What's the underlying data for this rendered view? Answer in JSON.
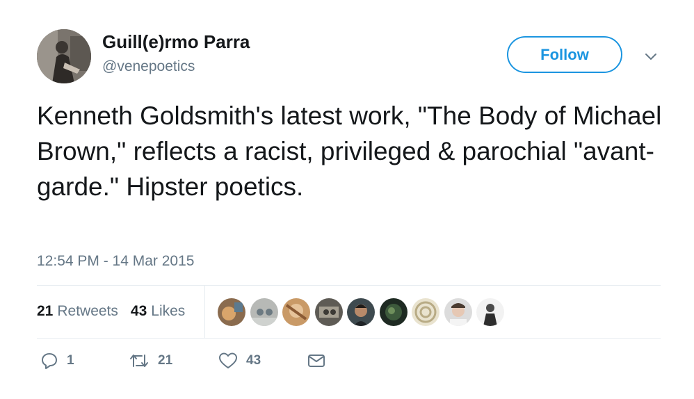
{
  "author": {
    "name": "Guill(e)rmo Parra",
    "handle": "@venepoetics",
    "avatar_icon": "profile-photo"
  },
  "follow_label": "Follow",
  "more_icon": "chevron-down-icon",
  "tweet": {
    "text": "Kenneth Goldsmith's latest work, \"The Body of Michael Brown,\" reflects a racist, privileged & parochial \"avant-garde.\" Hipster poetics.",
    "timestamp": "12:54 PM - 14 Mar 2015"
  },
  "stats": {
    "retweets_count": "21",
    "retweets_label": "Retweets",
    "likes_count": "43",
    "likes_label": "Likes"
  },
  "likers_count_shown": 9,
  "actions": {
    "reply_count": "1",
    "retweet_count": "21",
    "like_count": "43"
  },
  "colors": {
    "accent": "#1b95e0",
    "muted": "#657786",
    "text": "#14171a",
    "divider": "#e6ecf0"
  }
}
